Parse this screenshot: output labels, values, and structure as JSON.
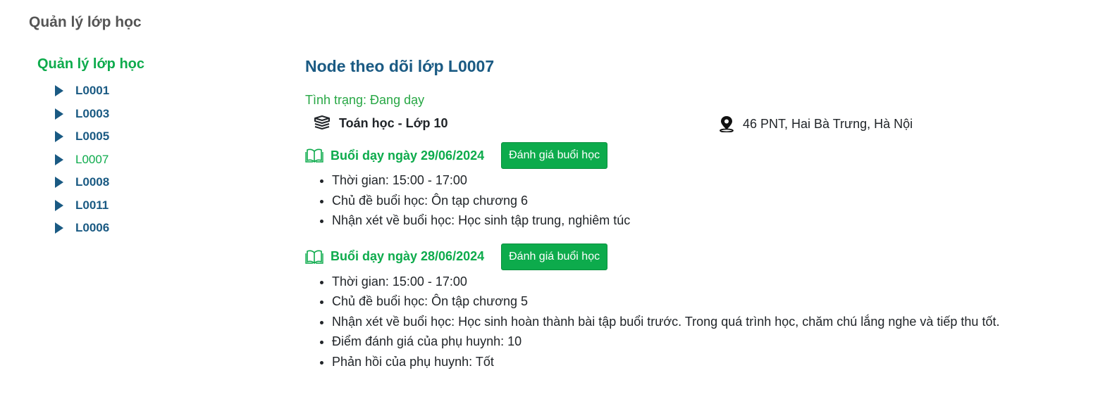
{
  "page": {
    "title": "Quản lý lớp học"
  },
  "sidebar": {
    "title": "Quản lý lớp học",
    "items": [
      {
        "label": "L0001",
        "active": false
      },
      {
        "label": "L0003",
        "active": false
      },
      {
        "label": "L0005",
        "active": false
      },
      {
        "label": "L0007",
        "active": true
      },
      {
        "label": "L0008",
        "active": false
      },
      {
        "label": "L0011",
        "active": false
      },
      {
        "label": "L0006",
        "active": false
      }
    ]
  },
  "main": {
    "title": "Node theo dõi lớp L0007",
    "status": "Tình trạng: Đang dạy",
    "subject": "Toán học - Lớp 10",
    "address": "46 PNT, Hai Bà Trưng, Hà Nội",
    "sessions": [
      {
        "title": "Buổi dạy ngày 29/06/2024",
        "button_label": "Đánh giá buổi học",
        "details": [
          "Thời gian: 15:00 - 17:00",
          "Chủ đề buổi học: Ôn tạp chương 6",
          "Nhận xét về buổi học: Học sinh tập trung, nghiêm túc"
        ]
      },
      {
        "title": "Buổi dạy ngày 28/06/2024",
        "button_label": "Đánh giá buổi học",
        "details": [
          "Thời gian: 15:00 - 17:00",
          "Chủ đề buổi học: Ôn tập chương 5",
          "Nhận xét về buổi học: Học sinh hoàn thành bài tập buổi trước. Trong quá trình học, chăm chú lắng nghe và tiếp thu tốt.",
          "Điểm đánh giá của phụ huynh: 10",
          "Phản hồi của phụ huynh: Tốt"
        ]
      }
    ]
  },
  "colors": {
    "accent_green": "#0dab4c",
    "link_blue": "#1a5a83",
    "heading_gray": "#555555"
  },
  "icons": {
    "tree_toggle": "triangle-right-icon",
    "subject": "books-icon",
    "address": "map-pin-icon",
    "session": "open-book-icon"
  }
}
